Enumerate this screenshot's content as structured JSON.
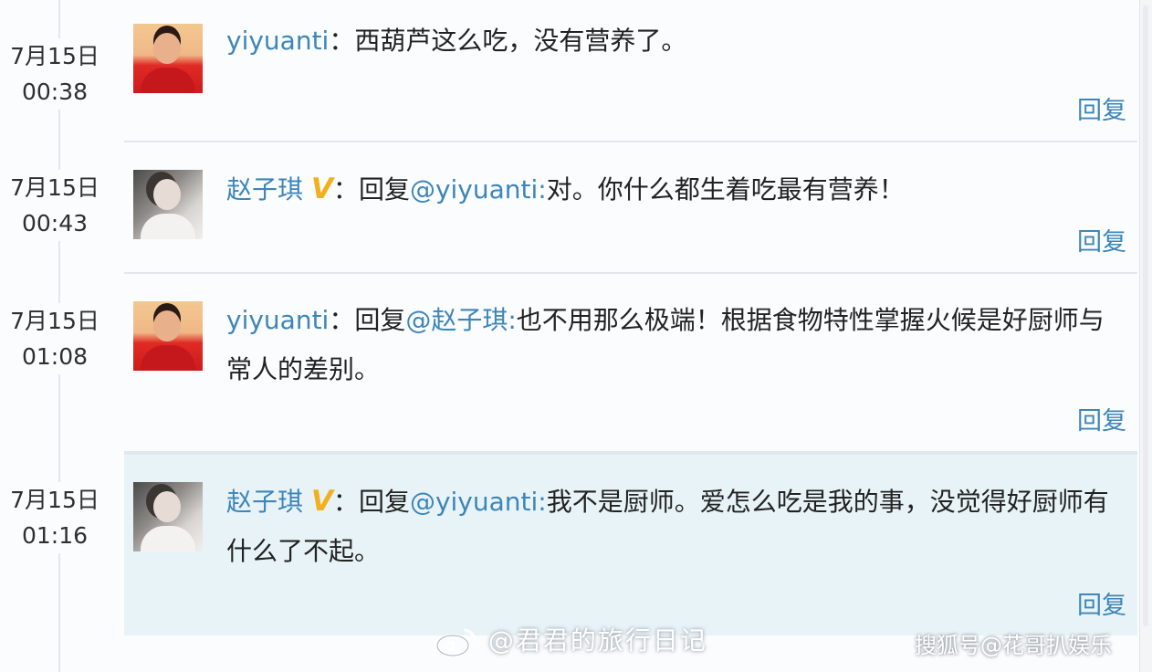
{
  "comments": [
    {
      "date": "7月15日",
      "time": "00:38",
      "user": "yiyuanti",
      "verified": false,
      "separator": "：",
      "reply_prefix": "",
      "mention": "",
      "text": "西葫芦这么吃，没有营养了。",
      "reply_label": "回复"
    },
    {
      "date": "7月15日",
      "time": "00:43",
      "user": "赵子琪",
      "verified": true,
      "badge": "V",
      "separator": "：",
      "reply_prefix": "回复",
      "mention": "@yiyuanti:",
      "text": "对。你什么都生着吃最有营养！",
      "reply_label": "回复"
    },
    {
      "date": "7月15日",
      "time": "01:08",
      "user": "yiyuanti",
      "verified": false,
      "separator": "：",
      "reply_prefix": "回复",
      "mention": "@赵子琪:",
      "text": "也不用那么极端！根据食物特性掌握火候是好厨师与常人的差别。",
      "reply_label": "回复"
    },
    {
      "date": "7月15日",
      "time": "01:16",
      "user": "赵子琪",
      "verified": true,
      "badge": "V",
      "separator": "：",
      "reply_prefix": "回复",
      "mention": "@yiyuanti:",
      "text": "我不是厨师。爱怎么吃是我的事，没觉得好厨师有什么了不起。",
      "reply_label": "回复"
    }
  ],
  "watermarks": {
    "weibo": "@君君的旅行日记",
    "sohu": "搜狐号@花哥扒娱乐"
  }
}
